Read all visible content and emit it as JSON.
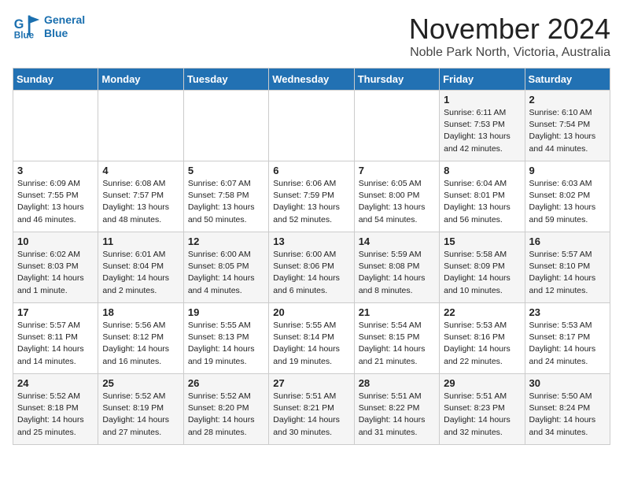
{
  "header": {
    "logo_line1": "General",
    "logo_line2": "Blue",
    "month": "November 2024",
    "location": "Noble Park North, Victoria, Australia"
  },
  "weekdays": [
    "Sunday",
    "Monday",
    "Tuesday",
    "Wednesday",
    "Thursday",
    "Friday",
    "Saturday"
  ],
  "weeks": [
    [
      {
        "day": "",
        "info": ""
      },
      {
        "day": "",
        "info": ""
      },
      {
        "day": "",
        "info": ""
      },
      {
        "day": "",
        "info": ""
      },
      {
        "day": "",
        "info": ""
      },
      {
        "day": "1",
        "info": "Sunrise: 6:11 AM\nSunset: 7:53 PM\nDaylight: 13 hours\nand 42 minutes."
      },
      {
        "day": "2",
        "info": "Sunrise: 6:10 AM\nSunset: 7:54 PM\nDaylight: 13 hours\nand 44 minutes."
      }
    ],
    [
      {
        "day": "3",
        "info": "Sunrise: 6:09 AM\nSunset: 7:55 PM\nDaylight: 13 hours\nand 46 minutes."
      },
      {
        "day": "4",
        "info": "Sunrise: 6:08 AM\nSunset: 7:57 PM\nDaylight: 13 hours\nand 48 minutes."
      },
      {
        "day": "5",
        "info": "Sunrise: 6:07 AM\nSunset: 7:58 PM\nDaylight: 13 hours\nand 50 minutes."
      },
      {
        "day": "6",
        "info": "Sunrise: 6:06 AM\nSunset: 7:59 PM\nDaylight: 13 hours\nand 52 minutes."
      },
      {
        "day": "7",
        "info": "Sunrise: 6:05 AM\nSunset: 8:00 PM\nDaylight: 13 hours\nand 54 minutes."
      },
      {
        "day": "8",
        "info": "Sunrise: 6:04 AM\nSunset: 8:01 PM\nDaylight: 13 hours\nand 56 minutes."
      },
      {
        "day": "9",
        "info": "Sunrise: 6:03 AM\nSunset: 8:02 PM\nDaylight: 13 hours\nand 59 minutes."
      }
    ],
    [
      {
        "day": "10",
        "info": "Sunrise: 6:02 AM\nSunset: 8:03 PM\nDaylight: 14 hours\nand 1 minute."
      },
      {
        "day": "11",
        "info": "Sunrise: 6:01 AM\nSunset: 8:04 PM\nDaylight: 14 hours\nand 2 minutes."
      },
      {
        "day": "12",
        "info": "Sunrise: 6:00 AM\nSunset: 8:05 PM\nDaylight: 14 hours\nand 4 minutes."
      },
      {
        "day": "13",
        "info": "Sunrise: 6:00 AM\nSunset: 8:06 PM\nDaylight: 14 hours\nand 6 minutes."
      },
      {
        "day": "14",
        "info": "Sunrise: 5:59 AM\nSunset: 8:08 PM\nDaylight: 14 hours\nand 8 minutes."
      },
      {
        "day": "15",
        "info": "Sunrise: 5:58 AM\nSunset: 8:09 PM\nDaylight: 14 hours\nand 10 minutes."
      },
      {
        "day": "16",
        "info": "Sunrise: 5:57 AM\nSunset: 8:10 PM\nDaylight: 14 hours\nand 12 minutes."
      }
    ],
    [
      {
        "day": "17",
        "info": "Sunrise: 5:57 AM\nSunset: 8:11 PM\nDaylight: 14 hours\nand 14 minutes."
      },
      {
        "day": "18",
        "info": "Sunrise: 5:56 AM\nSunset: 8:12 PM\nDaylight: 14 hours\nand 16 minutes."
      },
      {
        "day": "19",
        "info": "Sunrise: 5:55 AM\nSunset: 8:13 PM\nDaylight: 14 hours\nand 19 minutes."
      },
      {
        "day": "20",
        "info": "Sunrise: 5:55 AM\nSunset: 8:14 PM\nDaylight: 14 hours\nand 19 minutes."
      },
      {
        "day": "21",
        "info": "Sunrise: 5:54 AM\nSunset: 8:15 PM\nDaylight: 14 hours\nand 21 minutes."
      },
      {
        "day": "22",
        "info": "Sunrise: 5:53 AM\nSunset: 8:16 PM\nDaylight: 14 hours\nand 22 minutes."
      },
      {
        "day": "23",
        "info": "Sunrise: 5:53 AM\nSunset: 8:17 PM\nDaylight: 14 hours\nand 24 minutes."
      }
    ],
    [
      {
        "day": "24",
        "info": "Sunrise: 5:52 AM\nSunset: 8:18 PM\nDaylight: 14 hours\nand 25 minutes."
      },
      {
        "day": "25",
        "info": "Sunrise: 5:52 AM\nSunset: 8:19 PM\nDaylight: 14 hours\nand 27 minutes."
      },
      {
        "day": "26",
        "info": "Sunrise: 5:52 AM\nSunset: 8:20 PM\nDaylight: 14 hours\nand 28 minutes."
      },
      {
        "day": "27",
        "info": "Sunrise: 5:51 AM\nSunset: 8:21 PM\nDaylight: 14 hours\nand 30 minutes."
      },
      {
        "day": "28",
        "info": "Sunrise: 5:51 AM\nSunset: 8:22 PM\nDaylight: 14 hours\nand 31 minutes."
      },
      {
        "day": "29",
        "info": "Sunrise: 5:51 AM\nSunset: 8:23 PM\nDaylight: 14 hours\nand 32 minutes."
      },
      {
        "day": "30",
        "info": "Sunrise: 5:50 AM\nSunset: 8:24 PM\nDaylight: 14 hours\nand 34 minutes."
      }
    ]
  ]
}
